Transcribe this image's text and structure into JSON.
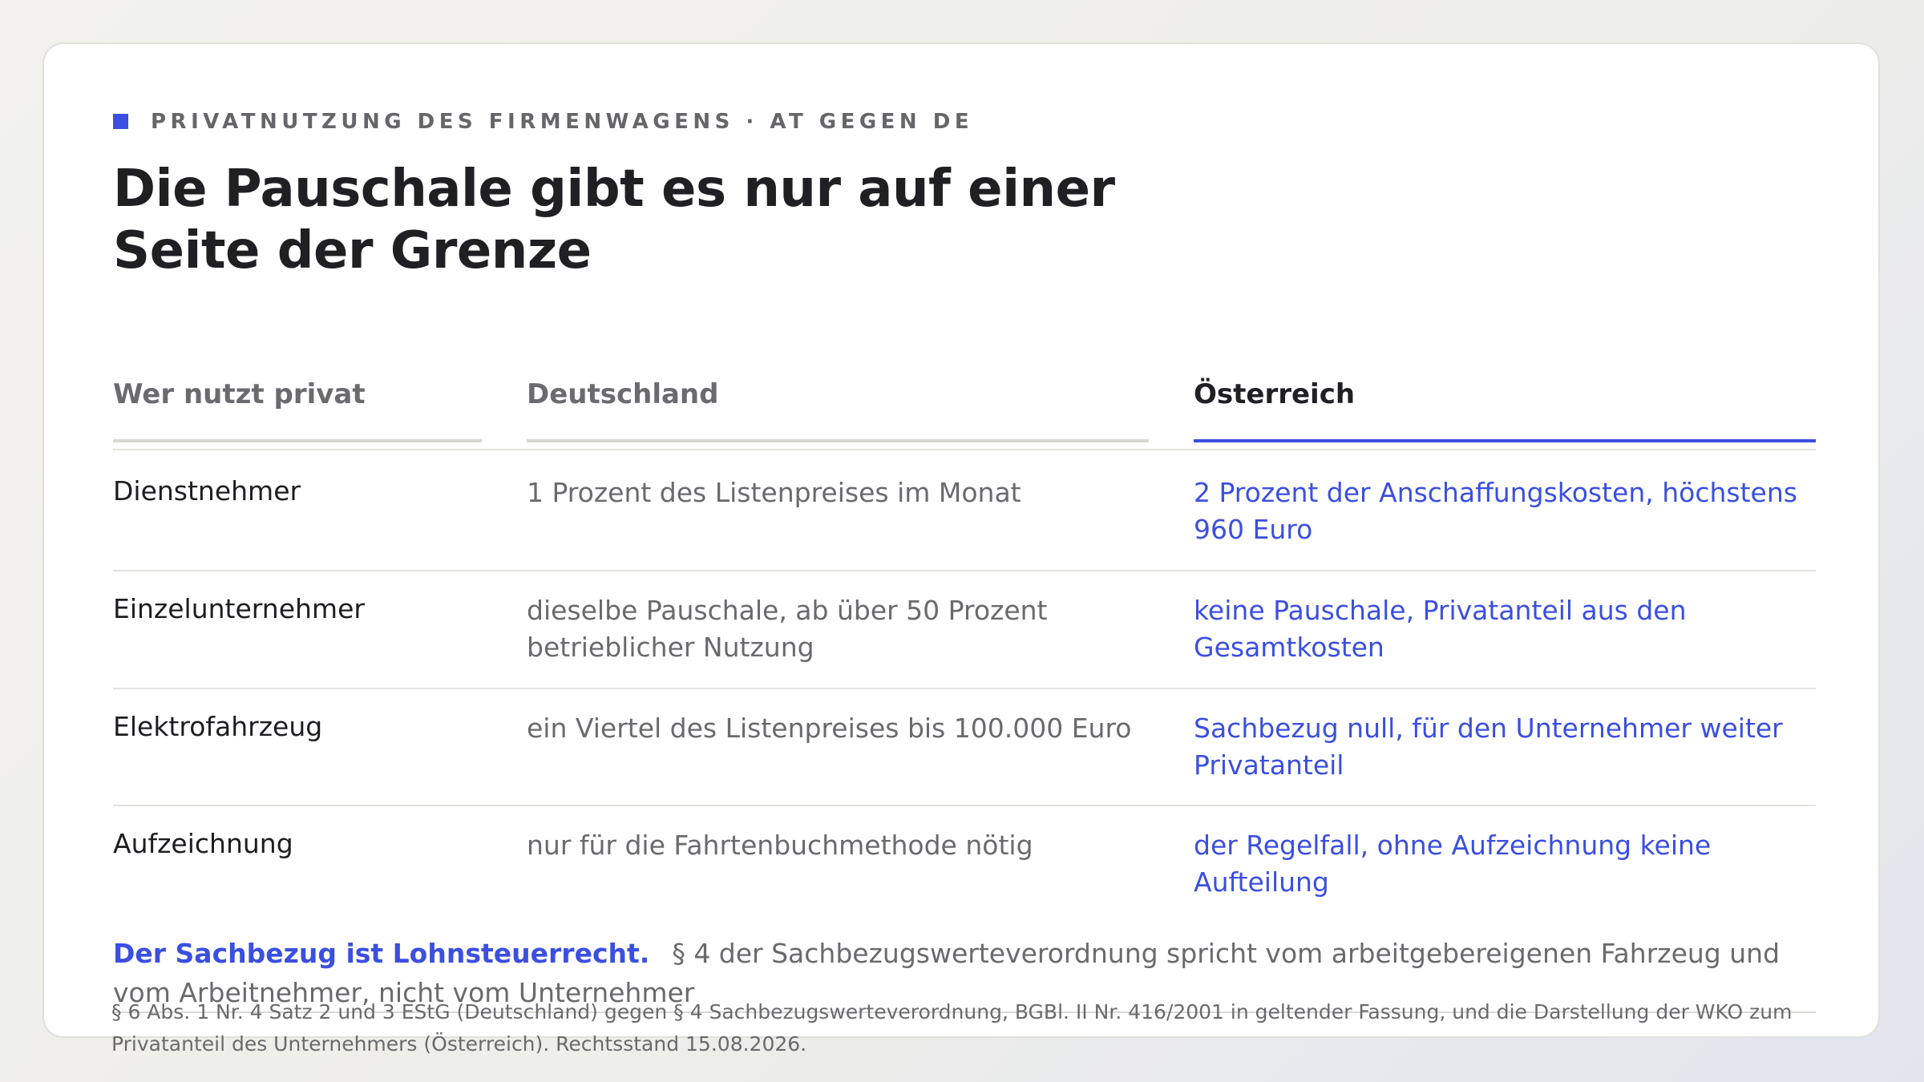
{
  "kicker": "PRIVATNUTZUNG DES FIRMENWAGENS · AT GEGEN DE",
  "title_line1": "Die Pauschale gibt es nur auf einer",
  "title_line2": "Seite der Grenze",
  "colors": {
    "accent": "#3b4fe0",
    "text": "#202024",
    "muted": "#6a6a6e"
  },
  "table": {
    "headers": [
      "Wer nutzt privat",
      "Deutschland",
      "Österreich"
    ],
    "active_header": "Österreich",
    "rows": [
      {
        "label": "Dienstnehmer",
        "de": "1 Prozent des Listenpreises im Monat",
        "at": "2 Prozent der Anschaffungskosten, höchstens 960 Euro"
      },
      {
        "label": "Einzelunternehmer",
        "de": "dieselbe Pauschale, ab über 50 Prozent betrieblicher Nutzung",
        "at": "keine Pauschale, Privatanteil aus den Gesamtkosten"
      },
      {
        "label": "Elektrofahrzeug",
        "de": "ein Viertel des Listenpreises bis 100.000 Euro",
        "at": "Sachbezug null, für den Unternehmer weiter Privatanteil"
      },
      {
        "label": "Aufzeichnung",
        "de": "nur für die Fahrtenbuchmethode nötig",
        "at": "der Regelfall, ohne Aufzeichnung keine Aufteilung"
      }
    ]
  },
  "note": {
    "strong": "Der Sachbezug ist Lohnsteuerrecht.",
    "text": "§ 4 der Sachbezugswerteverordnung spricht vom arbeitgebereigenen Fahrzeug und vom Arbeitnehmer, nicht vom Unternehmer"
  },
  "source": "§ 6 Abs. 1 Nr. 4 Satz 2 und 3 EStG (Deutschland) gegen § 4 Sachbezugswerteverordnung, BGBl. II Nr. 416/2001 in geltender Fassung, und die Darstellung der WKO zum Privatanteil des Unternehmers (Österreich). Rechtsstand 15.08.2026."
}
